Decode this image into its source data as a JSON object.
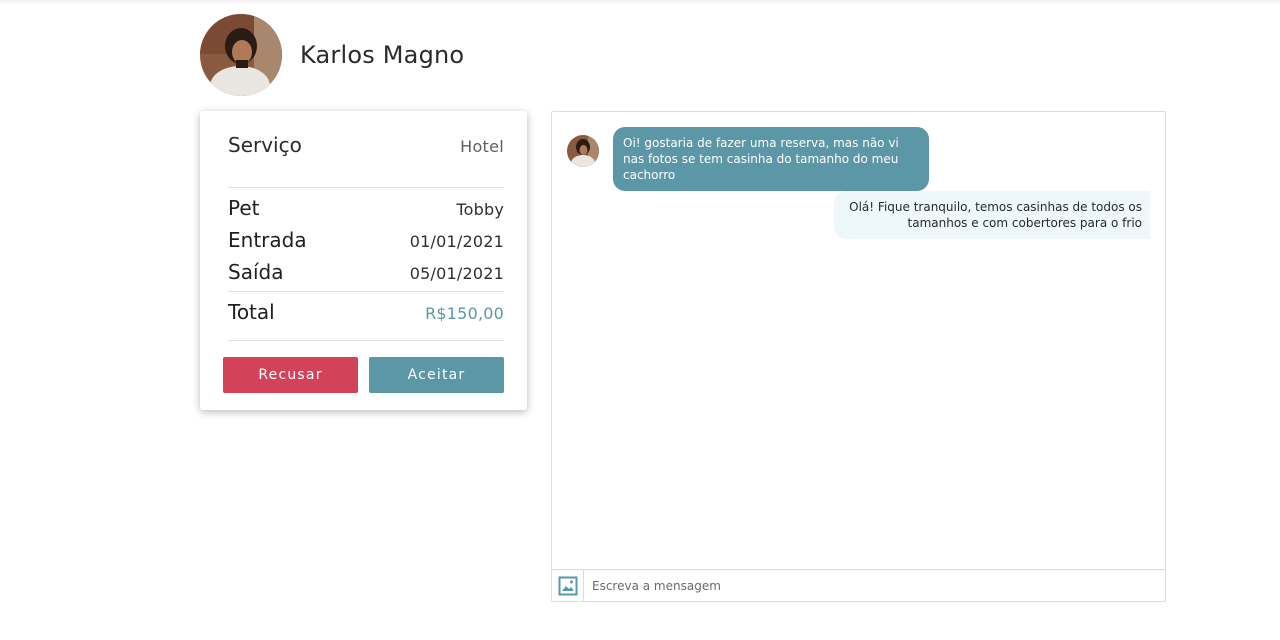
{
  "user": {
    "name": "Karlos Magno"
  },
  "service_card": {
    "service_label": "Serviço",
    "service_value": "Hotel",
    "pet_label": "Pet",
    "pet_value": "Tobby",
    "entry_label": "Entrada",
    "entry_value": "01/01/2021",
    "exit_label": "Saída",
    "exit_value": "05/01/2021",
    "total_label": "Total",
    "total_value": "R$150,00",
    "refuse_label": "Recusar",
    "accept_label": "Aceitar"
  },
  "chat": {
    "messages": [
      {
        "from": "user",
        "text": "Oi! gostaria de fazer uma reserva, mas não vi nas fotos se tem casinha do tamanho do meu cachorro"
      },
      {
        "from": "me",
        "text": "Olá! Fique tranquilo, temos casinhas de todos os tamanhos e com cobertores para o frio"
      }
    ],
    "composer": {
      "placeholder": "Escreva a mensagem",
      "image_icon": "image-icon"
    }
  },
  "colors": {
    "accent": "#5b97a7",
    "refuse": "#d24359",
    "incoming_bubble": "#5b97a7",
    "outgoing_bubble": "#eef7fa"
  }
}
